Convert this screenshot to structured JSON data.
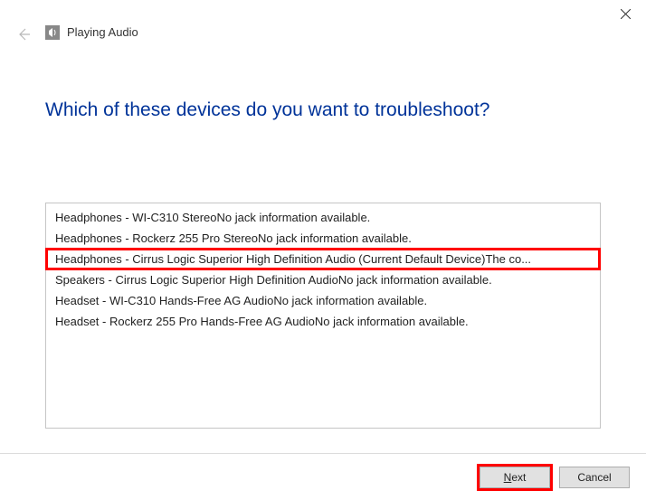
{
  "titlebar": {
    "title": "Playing Audio"
  },
  "heading": "Which of these devices do you want to troubleshoot?",
  "devices": [
    {
      "label": "Headphones - WI-C310 StereoNo jack information available.",
      "selected": false
    },
    {
      "label": "Headphones - Rockerz 255 Pro StereoNo jack information available.",
      "selected": false
    },
    {
      "label": "Headphones - Cirrus Logic Superior High Definition Audio (Current Default Device)The co...",
      "selected": true
    },
    {
      "label": "Speakers - Cirrus Logic Superior High Definition AudioNo jack information available.",
      "selected": false
    },
    {
      "label": "Headset - WI-C310 Hands-Free AG AudioNo jack information available.",
      "selected": false
    },
    {
      "label": "Headset - Rockerz 255 Pro Hands-Free AG AudioNo jack information available.",
      "selected": false
    }
  ],
  "buttons": {
    "next": "Next",
    "cancel": "Cancel"
  }
}
